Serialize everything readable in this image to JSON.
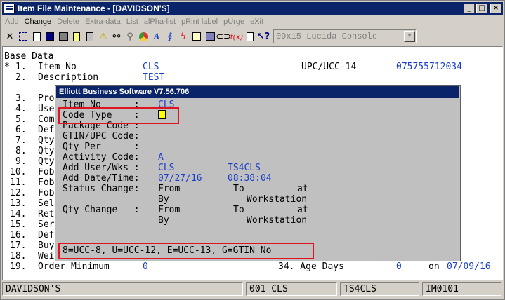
{
  "window": {
    "title": "Item File Maintenance - [DAVIDSON'S]"
  },
  "menu": [
    {
      "label": "Add",
      "enabled": false
    },
    {
      "label": "Change",
      "enabled": true
    },
    {
      "label": "Delete",
      "enabled": false
    },
    {
      "label": "Extra-data",
      "enabled": false
    },
    {
      "label": "List",
      "enabled": false
    },
    {
      "label": "alPha-list",
      "enabled": false
    },
    {
      "label": "pRint label",
      "enabled": false
    },
    {
      "label": "pUrge",
      "enabled": false
    },
    {
      "label": "eXit",
      "enabled": false
    }
  ],
  "toolbar": {
    "font_select": "09x15 Lucida Console"
  },
  "screen": {
    "section": "Base Data",
    "marker": "*",
    "rows": [
      {
        "num": "1.",
        "label": "Item No",
        "value": "CLS"
      },
      {
        "num": "2.",
        "label": "Description",
        "value": "TEST"
      },
      {
        "num": "3.",
        "label": "Pro"
      },
      {
        "num": "4.",
        "label": "Use"
      },
      {
        "num": "5.",
        "label": "Com"
      },
      {
        "num": "6.",
        "label": "Def"
      },
      {
        "num": "7.",
        "label": "Qty"
      },
      {
        "num": "8.",
        "label": "Qty"
      },
      {
        "num": "9.",
        "label": "Qty"
      },
      {
        "num": "10.",
        "label": "Fob"
      },
      {
        "num": "11.",
        "label": "Fob"
      },
      {
        "num": "12.",
        "label": "Fob"
      },
      {
        "num": "13.",
        "label": "Sel"
      },
      {
        "num": "14.",
        "label": "Ret"
      },
      {
        "num": "15.",
        "label": "Ser"
      },
      {
        "num": "16.",
        "label": "Def"
      },
      {
        "num": "17.",
        "label": "Buy"
      },
      {
        "num": "18.",
        "label": "Wei"
      },
      {
        "num": "19.",
        "label": "Order Minimum",
        "value": "0"
      }
    ],
    "upc_label": "UPC/UCC-14",
    "upc_value": "075755712034",
    "age_days_label": "34. Age Days",
    "age_days_value": "0",
    "age_on_label": "on",
    "age_on_date": "07/09/16"
  },
  "dialog": {
    "title": "Elliott Business Software V7.56.706",
    "item_no_label": "Item No      :",
    "item_no_value": "CLS",
    "code_type_label": "Code Type    :",
    "package_code_label": "Package Code :",
    "gtin_label": "GTIN/UPC Code:",
    "qty_per_label": "Qty Per      :",
    "activity_label": "Activity Code:",
    "activity_value": "A",
    "add_user_label": "Add User/Wks :",
    "add_user_value": "CLS",
    "add_wks_value": "TS4CLS",
    "add_date_label": "Add Date/Time:",
    "add_date_value": "07/27/16",
    "add_time_value": "08:38:04",
    "status_change_label": "Status Change:",
    "qty_change_label": "Qty Change   :",
    "from": "From",
    "to": "To",
    "at": "at",
    "by": "By",
    "workstation": "Workstation",
    "help_line": "8=UCC-8, U=UCC-12, E=UCC-13, G=GTIN No"
  },
  "statusbar": {
    "company": "DAVIDSON'S",
    "user": "001 CLS",
    "workstation": "TS4CLS",
    "program": "IM0101"
  },
  "colors": {
    "field_value": "#1a3ecb",
    "highlight": "#e0141e",
    "cursor": "#ffff00"
  }
}
